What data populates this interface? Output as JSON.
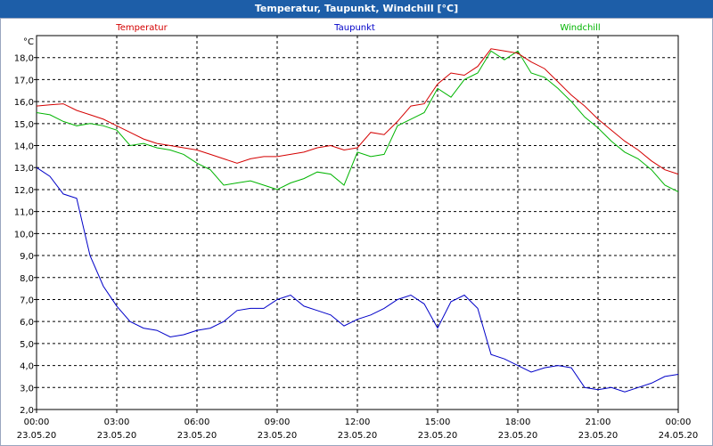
{
  "window": {
    "title": "Temperatur, Taupunkt, Windchill [°C]"
  },
  "chart_data": {
    "type": "line",
    "title": "Temperatur, Taupunkt, Windchill [°C]",
    "ylabel": "°C",
    "ylim": [
      2.0,
      19.0
    ],
    "yticks": [
      "2,0",
      "3,0",
      "4,0",
      "5,0",
      "6,0",
      "7,0",
      "8,0",
      "9,0",
      "10,0",
      "11,0",
      "12,0",
      "13,0",
      "14,0",
      "15,0",
      "16,0",
      "17,0",
      "18,0"
    ],
    "xlim_hours": [
      0,
      24
    ],
    "xticks": [
      {
        "time": "00:00",
        "date": "23.05.20"
      },
      {
        "time": "03:00",
        "date": "23.05.20"
      },
      {
        "time": "06:00",
        "date": "23.05.20"
      },
      {
        "time": "09:00",
        "date": "23.05.20"
      },
      {
        "time": "12:00",
        "date": "23.05.20"
      },
      {
        "time": "15:00",
        "date": "23.05.20"
      },
      {
        "time": "18:00",
        "date": "23.05.20"
      },
      {
        "time": "21:00",
        "date": "23.05.20"
      },
      {
        "time": "00:00",
        "date": "24.05.20"
      }
    ],
    "grid": true,
    "legend": "top",
    "x": [
      0.0,
      0.5,
      1.0,
      1.5,
      2.0,
      2.5,
      3.0,
      3.5,
      4.0,
      4.5,
      5.0,
      5.5,
      6.0,
      6.5,
      7.0,
      7.5,
      8.0,
      8.5,
      9.0,
      9.5,
      10.0,
      10.5,
      11.0,
      11.5,
      12.0,
      12.5,
      13.0,
      13.5,
      14.0,
      14.5,
      15.0,
      15.5,
      16.0,
      16.5,
      17.0,
      17.5,
      18.0,
      18.5,
      19.0,
      19.5,
      20.0,
      20.5,
      21.0,
      21.5,
      22.0,
      22.5,
      23.0,
      23.5,
      24.0
    ],
    "series": [
      {
        "name": "Temperatur",
        "color": "#d40000",
        "values": [
          15.8,
          15.85,
          15.9,
          15.6,
          15.4,
          15.2,
          14.9,
          14.6,
          14.3,
          14.1,
          14.0,
          13.9,
          13.8,
          13.6,
          13.4,
          13.2,
          13.4,
          13.5,
          13.5,
          13.6,
          13.7,
          13.9,
          14.0,
          13.8,
          13.9,
          14.6,
          14.5,
          15.1,
          15.8,
          15.9,
          16.8,
          17.3,
          17.2,
          17.6,
          18.4,
          18.3,
          18.2,
          17.8,
          17.5,
          16.9,
          16.3,
          15.8,
          15.2,
          14.7,
          14.2,
          13.8,
          13.3,
          12.9,
          12.7
        ]
      },
      {
        "name": "Taupunkt",
        "color": "#0000c8",
        "values": [
          13.0,
          12.6,
          11.8,
          11.6,
          9.0,
          7.6,
          6.7,
          6.0,
          5.7,
          5.6,
          5.3,
          5.4,
          5.6,
          5.7,
          6.0,
          6.5,
          6.6,
          6.6,
          7.0,
          7.2,
          6.7,
          6.5,
          6.3,
          5.8,
          6.1,
          6.3,
          6.6,
          7.0,
          7.2,
          6.8,
          5.7,
          6.9,
          7.2,
          6.6,
          4.5,
          4.3,
          4.0,
          3.7,
          3.9,
          4.0,
          3.9,
          3.0,
          2.9,
          3.0,
          2.8,
          3.0,
          3.2,
          3.5,
          3.6
        ]
      },
      {
        "name": "Windchill",
        "color": "#00b400",
        "values": [
          15.5,
          15.4,
          15.1,
          14.9,
          15.0,
          14.9,
          14.7,
          14.0,
          14.1,
          13.9,
          13.8,
          13.6,
          13.2,
          12.9,
          12.2,
          12.3,
          12.4,
          12.2,
          12.0,
          12.3,
          12.5,
          12.8,
          12.7,
          12.2,
          13.7,
          13.5,
          13.6,
          14.9,
          15.2,
          15.5,
          16.6,
          16.2,
          17.0,
          17.3,
          18.3,
          17.9,
          18.3,
          17.3,
          17.1,
          16.6,
          16.0,
          15.3,
          14.8,
          14.2,
          13.7,
          13.4,
          12.9,
          12.2,
          11.9
        ]
      }
    ]
  }
}
